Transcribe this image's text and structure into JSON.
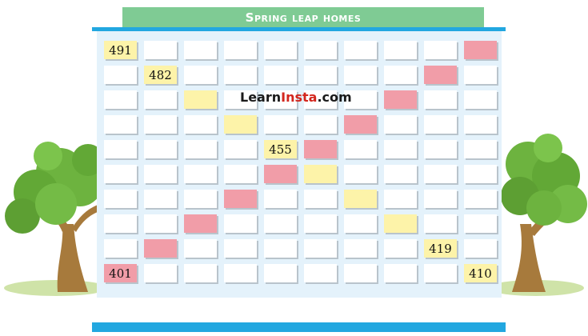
{
  "title": "Spring leap homes",
  "watermark": {
    "part1": "Learn",
    "part2": "Insta",
    "part3": ".com"
  },
  "colors": {
    "yellow": "#fdf3a9",
    "pink": "#f19da8",
    "banner": "#7fcb94",
    "blue": "#22a7e0"
  },
  "grid": {
    "columns": 10,
    "rows": [
      [
        {
          "t": "491",
          "c": "yellow"
        },
        {},
        {},
        {},
        {},
        {},
        {},
        {},
        {},
        {
          "c": "pink"
        }
      ],
      [
        {},
        {
          "t": "482",
          "c": "yellow"
        },
        {},
        {},
        {},
        {},
        {},
        {},
        {
          "c": "pink"
        },
        {}
      ],
      [
        {},
        {},
        {
          "c": "yellow"
        },
        {},
        {},
        {},
        {},
        {
          "c": "pink"
        },
        {},
        {}
      ],
      [
        {},
        {},
        {},
        {
          "c": "yellow"
        },
        {},
        {},
        {
          "c": "pink"
        },
        {},
        {},
        {}
      ],
      [
        {},
        {},
        {},
        {},
        {
          "t": "455",
          "c": "yellow"
        },
        {
          "c": "pink"
        },
        {},
        {},
        {},
        {}
      ],
      [
        {},
        {},
        {},
        {},
        {
          "c": "pink"
        },
        {
          "c": "yellow"
        },
        {},
        {},
        {},
        {}
      ],
      [
        {},
        {},
        {},
        {
          "c": "pink"
        },
        {},
        {},
        {
          "c": "yellow"
        },
        {},
        {},
        {}
      ],
      [
        {},
        {},
        {
          "c": "pink"
        },
        {},
        {},
        {},
        {},
        {
          "c": "yellow"
        },
        {},
        {}
      ],
      [
        {},
        {
          "c": "pink"
        },
        {},
        {},
        {},
        {},
        {},
        {},
        {
          "t": "419",
          "c": "yellow"
        },
        {}
      ],
      [
        {
          "t": "401",
          "c": "pink"
        },
        {},
        {},
        {},
        {},
        {},
        {},
        {},
        {},
        {
          "t": "410",
          "c": "yellow"
        }
      ]
    ]
  }
}
